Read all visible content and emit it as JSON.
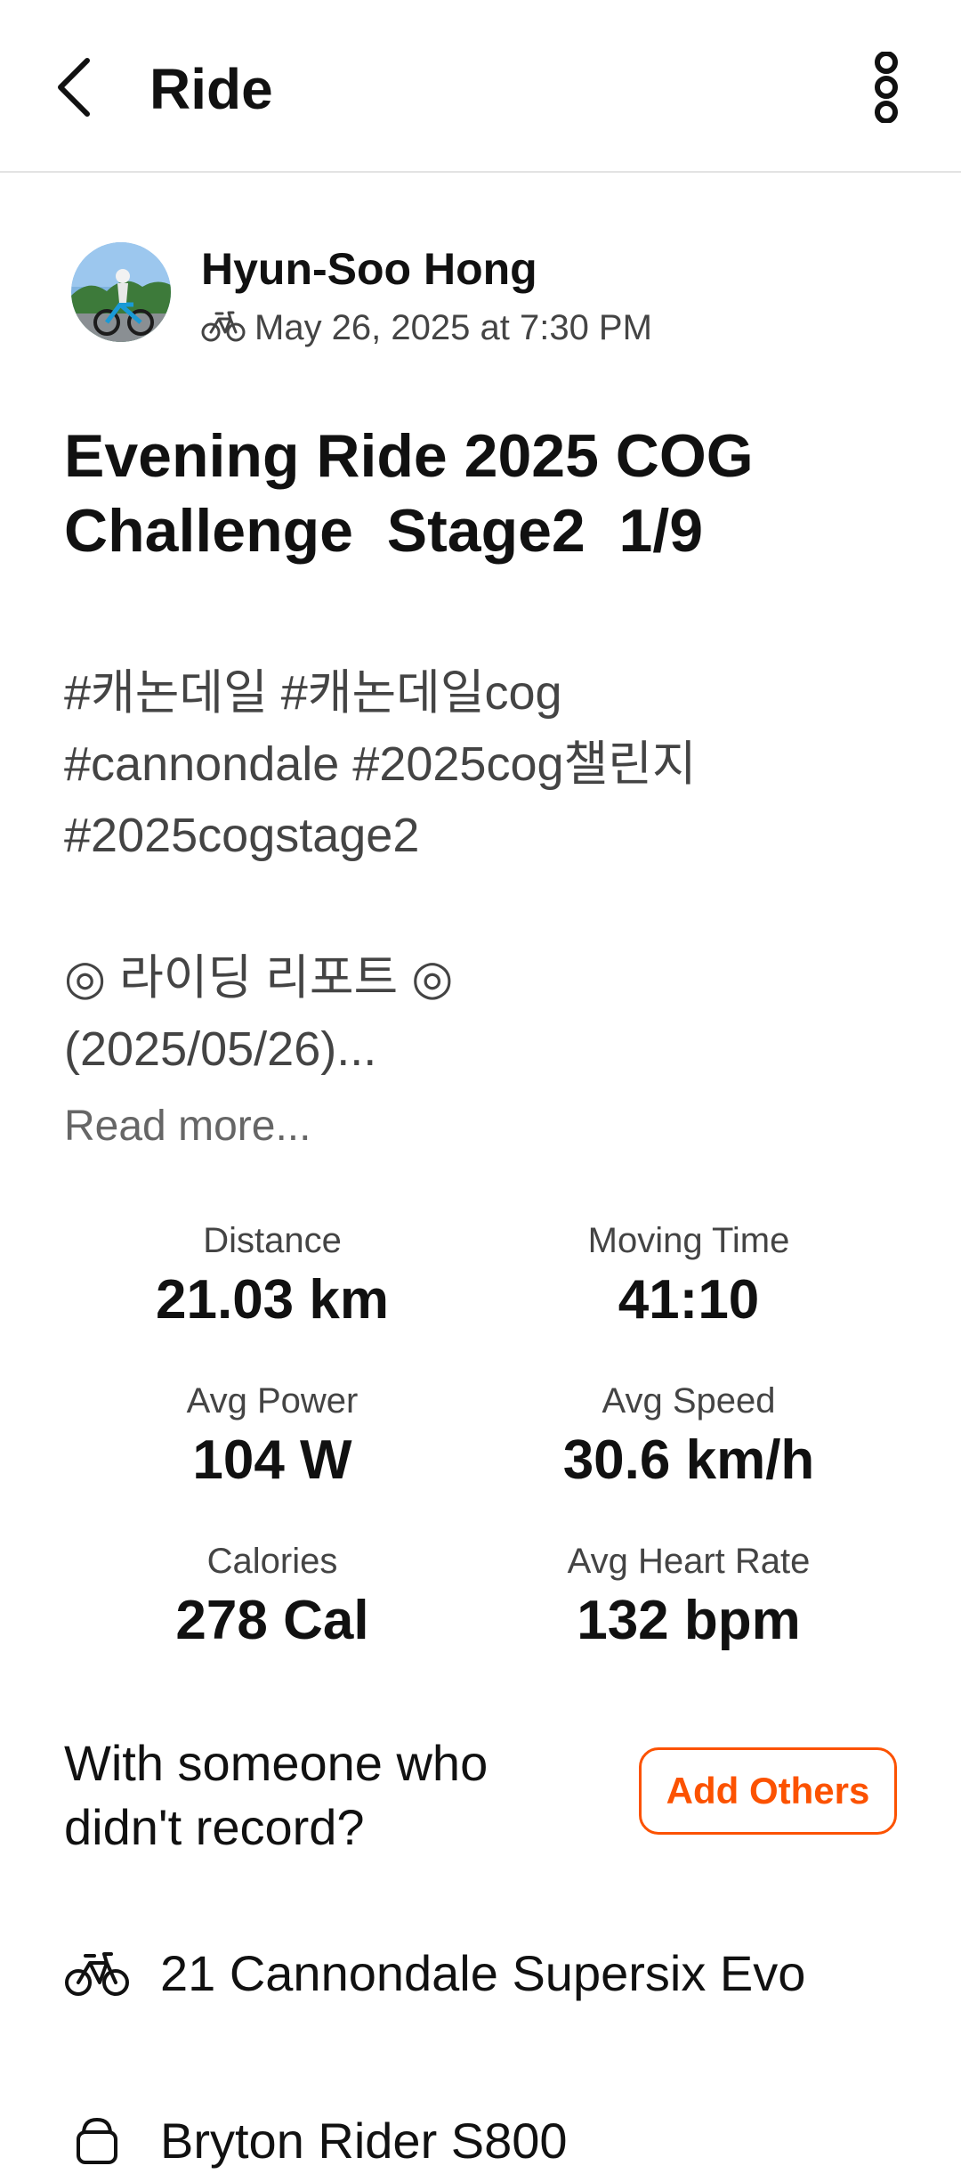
{
  "header": {
    "title": "Ride",
    "back_icon": "chevron-left-icon",
    "menu_icon": "more-vertical-icon"
  },
  "athlete": {
    "name": "Hyun-Soo Hong",
    "activity_icon": "bike-icon",
    "date": "May 26, 2025 at 7:30 PM"
  },
  "activity": {
    "title": "Evening Ride 2025 COG\nChallenge  Stage2  1/9",
    "description": "#캐논데일 #캐논데일cog\n#cannondale #2025cog챌린지\n#2025cogstage2\n\n◎ 라이딩 리포트 ◎\n(2025/05/26)...",
    "read_more": "Read more..."
  },
  "stats": [
    {
      "label": "Distance",
      "value": "21.03 km"
    },
    {
      "label": "Moving Time",
      "value": "41:10"
    },
    {
      "label": "Avg Power",
      "value": "104 W"
    },
    {
      "label": "Avg Speed",
      "value": "30.6 km/h"
    },
    {
      "label": "Calories",
      "value": "278 Cal"
    },
    {
      "label": "Avg Heart Rate",
      "value": "132 bpm"
    }
  ],
  "with_others": {
    "prompt": "With someone who didn't record?",
    "button_label": "Add Others"
  },
  "gear": [
    {
      "icon": "bike-icon",
      "label": "21 Cannondale Supersix Evo"
    },
    {
      "icon": "bike-computer-icon",
      "label": "Bryton Rider S800"
    }
  ],
  "colors": {
    "accent": "#fc5200",
    "text_primary": "#111111",
    "text_secondary": "#444444"
  }
}
